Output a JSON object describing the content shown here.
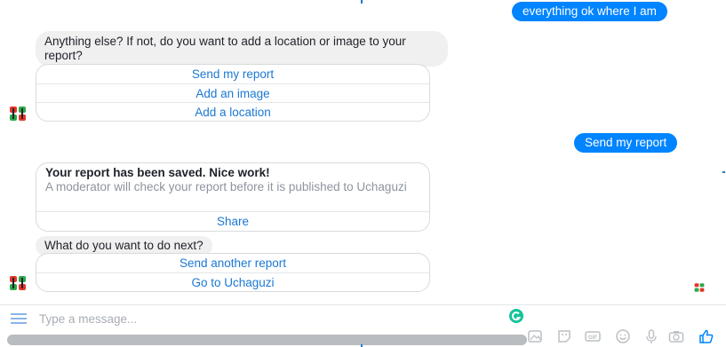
{
  "conversation": {
    "messages": [
      {
        "sender": "user",
        "text": "everything ok where I am"
      },
      {
        "sender": "bot",
        "text": "Anything else? If not, do you want to add a location or image to your report?"
      },
      {
        "sender": "bot",
        "quick_replies": [
          "Send my report",
          "Add an image",
          "Add a location"
        ]
      },
      {
        "sender": "user",
        "text": "Send my report"
      },
      {
        "sender": "bot",
        "card": {
          "title": "Your report has been saved. Nice work!",
          "subtitle": "A moderator will check your report before it is published to Uchaguzi",
          "action": "Share"
        }
      },
      {
        "sender": "bot",
        "text": "What do you want to do next?"
      },
      {
        "sender": "bot",
        "quick_replies": [
          "Send another report",
          "Go to Uchaguzi"
        ]
      }
    ]
  },
  "composer": {
    "placeholder": "Type a message..."
  },
  "icons": {
    "menu": "menu-icon",
    "grammarly": "grammarly-icon",
    "toolbar": [
      "image-icon",
      "sticker-icon",
      "gif-icon",
      "emoji-icon",
      "microphone-icon",
      "camera-icon",
      "thumbs-up-icon"
    ]
  },
  "colors": {
    "user_bubble": "#0084ff",
    "bot_bubble": "#f1f0f0",
    "link_blue": "#1b78d3",
    "avatar_red": "#e4352b",
    "avatar_green": "#2ba84a"
  }
}
